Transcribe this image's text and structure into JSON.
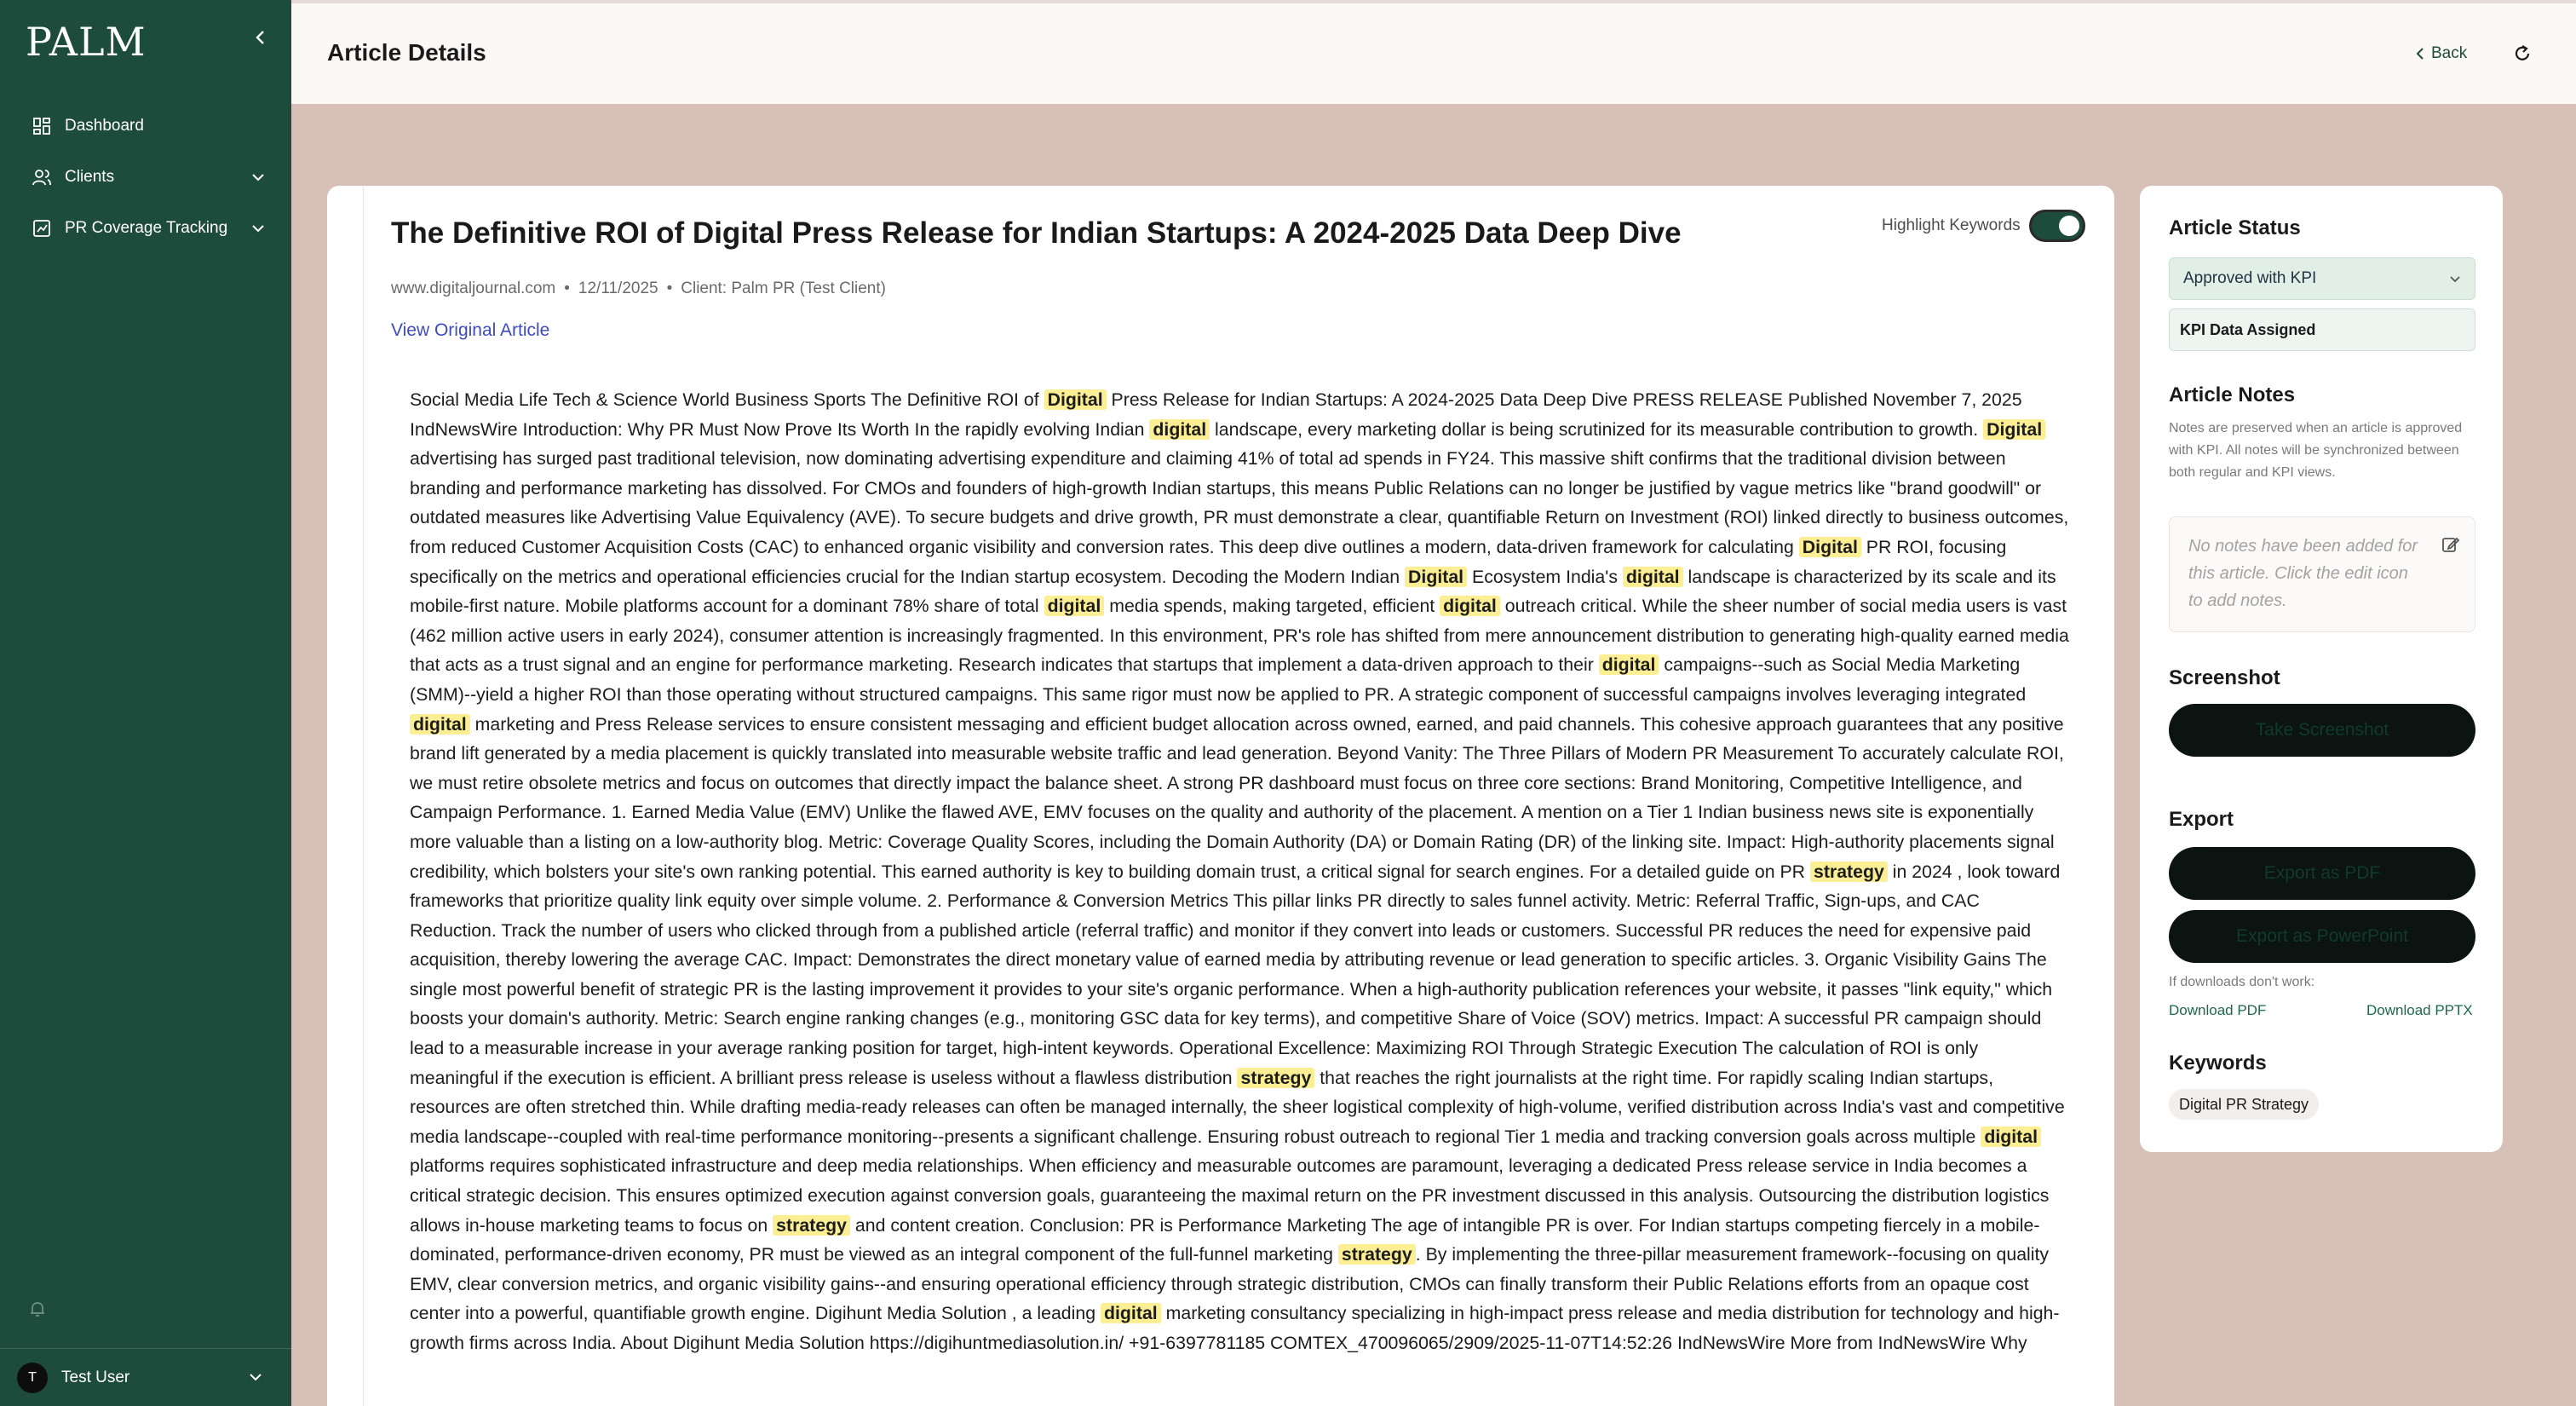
{
  "sidebar": {
    "logo": "PALM",
    "items": [
      {
        "label": "Dashboard",
        "icon": "dashboard-icon"
      },
      {
        "label": "Clients",
        "icon": "users-icon"
      },
      {
        "label": "PR Coverage Tracking",
        "icon": "chart-icon"
      }
    ],
    "user": {
      "initial": "T",
      "name": "Test User"
    }
  },
  "header": {
    "title": "Article Details",
    "back_label": "Back"
  },
  "article": {
    "title": "The Definitive ROI of Digital Press Release for Indian Startups: A 2024-2025 Data Deep Dive",
    "highlight_label": "Highlight Keywords",
    "highlight_on": true,
    "source": "www.digitaljournal.com",
    "date": "12/11/2025",
    "client": "Client: Palm PR (Test Client)",
    "view_link": "View Original Article",
    "segments": [
      {
        "t": "Social Media Life Tech & Science World Business Sports The Definitive ROI of "
      },
      {
        "t": "Digital",
        "kw": true
      },
      {
        "t": " Press Release for Indian Startups: A 2024-2025 Data Deep Dive PRESS RELEASE Published November 7, 2025 IndNewsWire Introduction: Why PR Must Now Prove Its Worth In the rapidly evolving Indian "
      },
      {
        "t": "digital",
        "kw": true
      },
      {
        "t": " landscape, every marketing dollar is being scrutinized for its measurable contribution to growth. "
      },
      {
        "t": "Digital",
        "kw": true
      },
      {
        "t": " advertising has surged past traditional television, now dominating advertising expenditure and claiming 41% of total ad spends in FY24. This massive shift confirms that the traditional division between branding and performance marketing has dissolved. For CMOs and founders of high-growth Indian startups, this means Public Relations can no longer be justified by vague metrics like \"brand goodwill\" or outdated measures like Advertising Value Equivalency (AVE). To secure budgets and drive growth, PR must demonstrate a clear, quantifiable Return on Investment (ROI) linked directly to business outcomes, from reduced Customer Acquisition Costs (CAC) to enhanced organic visibility and conversion rates. This deep dive outlines a modern, data-driven framework for calculating "
      },
      {
        "t": "Digital",
        "kw": true
      },
      {
        "t": " PR ROI, focusing specifically on the metrics and operational efficiencies crucial for the Indian startup ecosystem. Decoding the Modern Indian "
      },
      {
        "t": "Digital",
        "kw": true
      },
      {
        "t": " Ecosystem India's "
      },
      {
        "t": "digital",
        "kw": true
      },
      {
        "t": " landscape is characterized by its scale and its mobile-first nature. Mobile platforms account for a dominant 78% share of total "
      },
      {
        "t": "digital",
        "kw": true
      },
      {
        "t": " media spends, making targeted, efficient "
      },
      {
        "t": "digital",
        "kw": true
      },
      {
        "t": " outreach critical. While the sheer number of social media users is vast (462 million active users in early 2024), consumer attention is increasingly fragmented. In this environment, PR's role has shifted from mere announcement distribution to generating high-quality earned media that acts as a trust signal and an engine for performance marketing. Research indicates that startups that implement a data-driven approach to their "
      },
      {
        "t": "digital",
        "kw": true
      },
      {
        "t": " campaigns--such as Social Media Marketing (SMM)--yield a higher ROI than those operating without structured campaigns. This same rigor must now be applied to PR. A strategic component of successful campaigns involves leveraging integrated "
      },
      {
        "t": "digital",
        "kw": true
      },
      {
        "t": " marketing and Press Release services to ensure consistent messaging and efficient budget allocation across owned, earned, and paid channels. This cohesive approach guarantees that any positive brand lift generated by a media placement is quickly translated into measurable website traffic and lead generation. Beyond Vanity: The Three Pillars of Modern PR Measurement To accurately calculate ROI, we must retire obsolete metrics and focus on outcomes that directly impact the balance sheet. A strong PR dashboard must focus on three core sections: Brand Monitoring, Competitive Intelligence, and Campaign Performance. 1. Earned Media Value (EMV) Unlike the flawed AVE, EMV focuses on the quality and authority of the placement. A mention on a Tier 1 Indian business news site is exponentially more valuable than a listing on a low-authority blog. Metric: Coverage Quality Scores, including the Domain Authority (DA) or Domain Rating (DR) of the linking site. Impact: High-authority placements signal credibility, which bolsters your site's own ranking potential. This earned authority is key to building domain trust, a critical signal for search engines. For a detailed guide on PR "
      },
      {
        "t": "strategy",
        "kw": true
      },
      {
        "t": " in 2024 , look toward frameworks that prioritize quality link equity over simple volume. 2. Performance & Conversion Metrics This pillar links PR directly to sales funnel activity. Metric: Referral Traffic, Sign-ups, and CAC Reduction. Track the number of users who clicked through from a published article (referral traffic) and monitor if they convert into leads or customers. Successful PR reduces the need for expensive paid acquisition, thereby lowering the average CAC. Impact: Demonstrates the direct monetary value of earned media by attributing revenue or lead generation to specific articles. 3. Organic Visibility Gains The single most powerful benefit of strategic PR is the lasting improvement it provides to your site's organic performance. When a high-authority publication references your website, it passes \"link equity,\" which boosts your domain's authority. Metric: Search engine ranking changes (e.g., monitoring GSC data for key terms), and competitive Share of Voice (SOV) metrics. Impact: A successful PR campaign should lead to a measurable increase in your average ranking position for target, high-intent keywords. Operational Excellence: Maximizing ROI Through Strategic Execution The calculation of ROI is only meaningful if the execution is efficient. A brilliant press release is useless without a flawless distribution "
      },
      {
        "t": "strategy",
        "kw": true
      },
      {
        "t": " that reaches the right journalists at the right time. For rapidly scaling Indian startups, resources are often stretched thin. While drafting media-ready releases can often be managed internally, the sheer logistical complexity of high-volume, verified distribution across India's vast and competitive media landscape--coupled with real-time performance monitoring--presents a significant challenge. Ensuring robust outreach to regional Tier 1 media and tracking conversion goals across multiple "
      },
      {
        "t": "digital",
        "kw": true
      },
      {
        "t": " platforms requires sophisticated infrastructure and deep media relationships. When efficiency and measurable outcomes are paramount, leveraging a dedicated Press release service in India becomes a critical strategic decision. This ensures optimized execution against conversion goals, guaranteeing the maximal return on the PR investment discussed in this analysis. Outsourcing the distribution logistics allows in-house marketing teams to focus on "
      },
      {
        "t": "strategy",
        "kw": true
      },
      {
        "t": " and content creation. Conclusion: PR is Performance Marketing The age of intangible PR is over. For Indian startups competing fiercely in a mobile-dominated, performance-driven economy, PR must be viewed as an integral component of the full-funnel marketing "
      },
      {
        "t": "strategy",
        "kw": true
      },
      {
        "t": ". By implementing the three-pillar measurement framework--focusing on quality EMV, clear conversion metrics, and organic visibility gains--and ensuring operational efficiency through strategic distribution, CMOs can finally transform their Public Relations efforts from an opaque cost center into a powerful, quantifiable growth engine. Digihunt Media Solution , a leading "
      },
      {
        "t": "digital",
        "kw": true
      },
      {
        "t": " marketing consultancy specializing in high-impact press release and media distribution for technology and high-growth firms across India. About Digihunt Media Solution https://digihuntmediasolution.in/ +91-6397781185 COMTEX_470096065/2909/2025-11-07T14:52:26 IndNewsWire More from IndNewsWire Why"
      }
    ]
  },
  "panel": {
    "status_title": "Article Status",
    "status_value": "Approved with KPI",
    "kpi_label": "KPI Data Assigned",
    "notes_title": "Article Notes",
    "notes_desc": "Notes are preserved when an article is approved with KPI. All notes will be synchronized between both regular and KPI views.",
    "notes_placeholder": "No notes have been added for this article. Click the edit icon to add notes.",
    "screenshot_title": "Screenshot",
    "screenshot_btn": "Take Screenshot",
    "export_title": "Export",
    "export_pdf": "Export as PDF",
    "export_ppt": "Export as PowerPoint",
    "dl_hint": "If downloads don't work:",
    "dl_pdf": "Download PDF",
    "dl_pptx": "Download PPTX",
    "keywords_title": "Keywords",
    "keywords": [
      "Digital PR Strategy"
    ]
  },
  "colors": {
    "sidebar": "#1d4b3c",
    "accent": "#1d4b3c",
    "highlight": "#fbee93",
    "link": "#3e4bbd"
  }
}
